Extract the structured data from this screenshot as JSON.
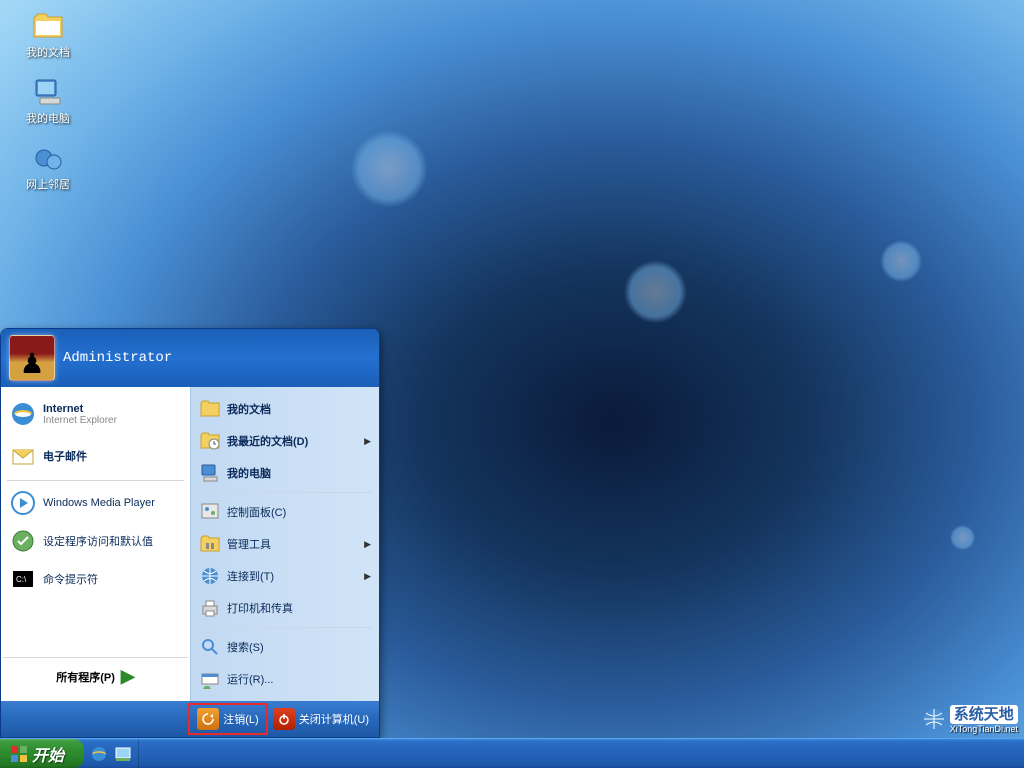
{
  "desktop_icons": [
    {
      "label": "我的文档",
      "name": "desktop-icon-my-documents",
      "icon": "folder-icon"
    },
    {
      "label": "我的电脑",
      "name": "desktop-icon-my-computer",
      "icon": "computer-icon"
    },
    {
      "label": "网上邻居",
      "name": "desktop-icon-network",
      "icon": "network-icon"
    }
  ],
  "start_button": "开始",
  "start_menu": {
    "user": "Administrator",
    "left": [
      {
        "type": "dual",
        "main": "Internet",
        "sub": "Internet Explorer",
        "icon": "ie-icon",
        "name": "sm-internet"
      },
      {
        "type": "dual",
        "main": "电子邮件",
        "sub": "",
        "icon": "mail-icon",
        "name": "sm-email"
      },
      {
        "type": "sep"
      },
      {
        "type": "item",
        "label": "Windows Media Player",
        "icon": "wmp-icon",
        "name": "sm-wmp"
      },
      {
        "type": "item",
        "label": "设定程序访问和默认值",
        "icon": "defaults-icon",
        "name": "sm-program-defaults"
      },
      {
        "type": "item",
        "label": "命令提示符",
        "icon": "cmd-icon",
        "name": "sm-cmd"
      }
    ],
    "all_programs": "所有程序(P)",
    "right": [
      {
        "label": "我的文档",
        "icon": "folder-icon",
        "name": "sm-my-docs",
        "bold": true
      },
      {
        "label": "我最近的文档(D)",
        "icon": "folder-recent-icon",
        "name": "sm-recent-docs",
        "bold": true,
        "submenu": true
      },
      {
        "label": "我的电脑",
        "icon": "computer-icon",
        "name": "sm-my-computer",
        "bold": true
      },
      {
        "type": "sep"
      },
      {
        "label": "控制面板(C)",
        "icon": "control-panel-icon",
        "name": "sm-control-panel"
      },
      {
        "label": "管理工具",
        "icon": "admin-tools-icon",
        "name": "sm-admin-tools",
        "submenu": true
      },
      {
        "label": "连接到(T)",
        "icon": "connect-icon",
        "name": "sm-connect",
        "submenu": true
      },
      {
        "label": "打印机和传真",
        "icon": "printer-icon",
        "name": "sm-printers"
      },
      {
        "type": "sep"
      },
      {
        "label": "搜索(S)",
        "icon": "search-icon",
        "name": "sm-search"
      },
      {
        "label": "运行(R)...",
        "icon": "run-icon",
        "name": "sm-run"
      }
    ],
    "footer": {
      "logoff": "注销(L)",
      "shutdown": "关闭计算机(U)"
    }
  },
  "watermark": {
    "main": "系统天地",
    "sub": "XiTongTianDi.net"
  }
}
